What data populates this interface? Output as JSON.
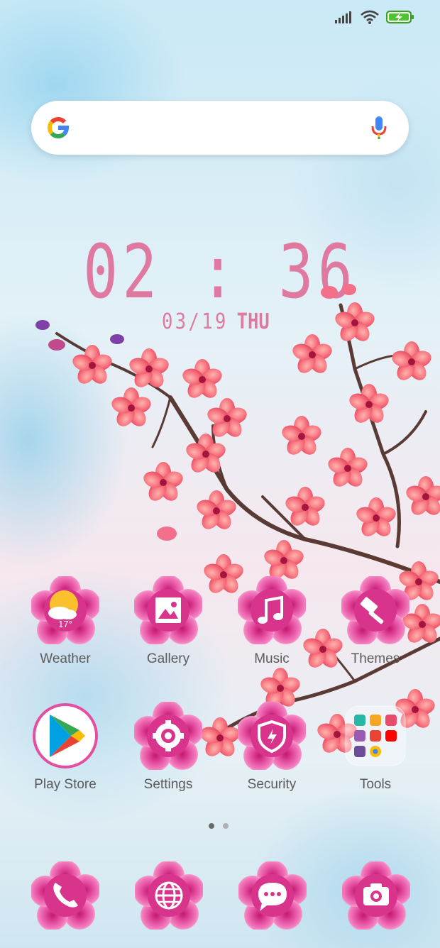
{
  "status_bar": {
    "icons": [
      "signal-icon",
      "wifi-icon",
      "battery-charging-icon"
    ]
  },
  "search": {
    "icon": "google-g-icon",
    "mic_icon": "mic-icon"
  },
  "clock": {
    "time": "02 : 36",
    "date": "03/19",
    "day": "THU"
  },
  "apps": [
    {
      "label": "Weather",
      "icon": "weather-icon",
      "temp": "17°"
    },
    {
      "label": "Gallery",
      "icon": "gallery-icon"
    },
    {
      "label": "Music",
      "icon": "music-icon"
    },
    {
      "label": "Themes",
      "icon": "themes-icon"
    },
    {
      "label": "Play Store",
      "icon": "play-store-icon"
    },
    {
      "label": "Settings",
      "icon": "settings-icon"
    },
    {
      "label": "Security",
      "icon": "security-icon"
    },
    {
      "label": "Tools",
      "icon": "tools-folder-icon"
    }
  ],
  "page_indicator": {
    "pages": 2,
    "current": 1
  },
  "dock": [
    {
      "icon": "phone-icon"
    },
    {
      "icon": "browser-icon"
    },
    {
      "icon": "messages-icon"
    },
    {
      "icon": "camera-icon"
    }
  ],
  "colors": {
    "accent_pink": "#e079a0",
    "flower_pink": "#e94fa4",
    "label_gray": "#5b5b5b"
  }
}
